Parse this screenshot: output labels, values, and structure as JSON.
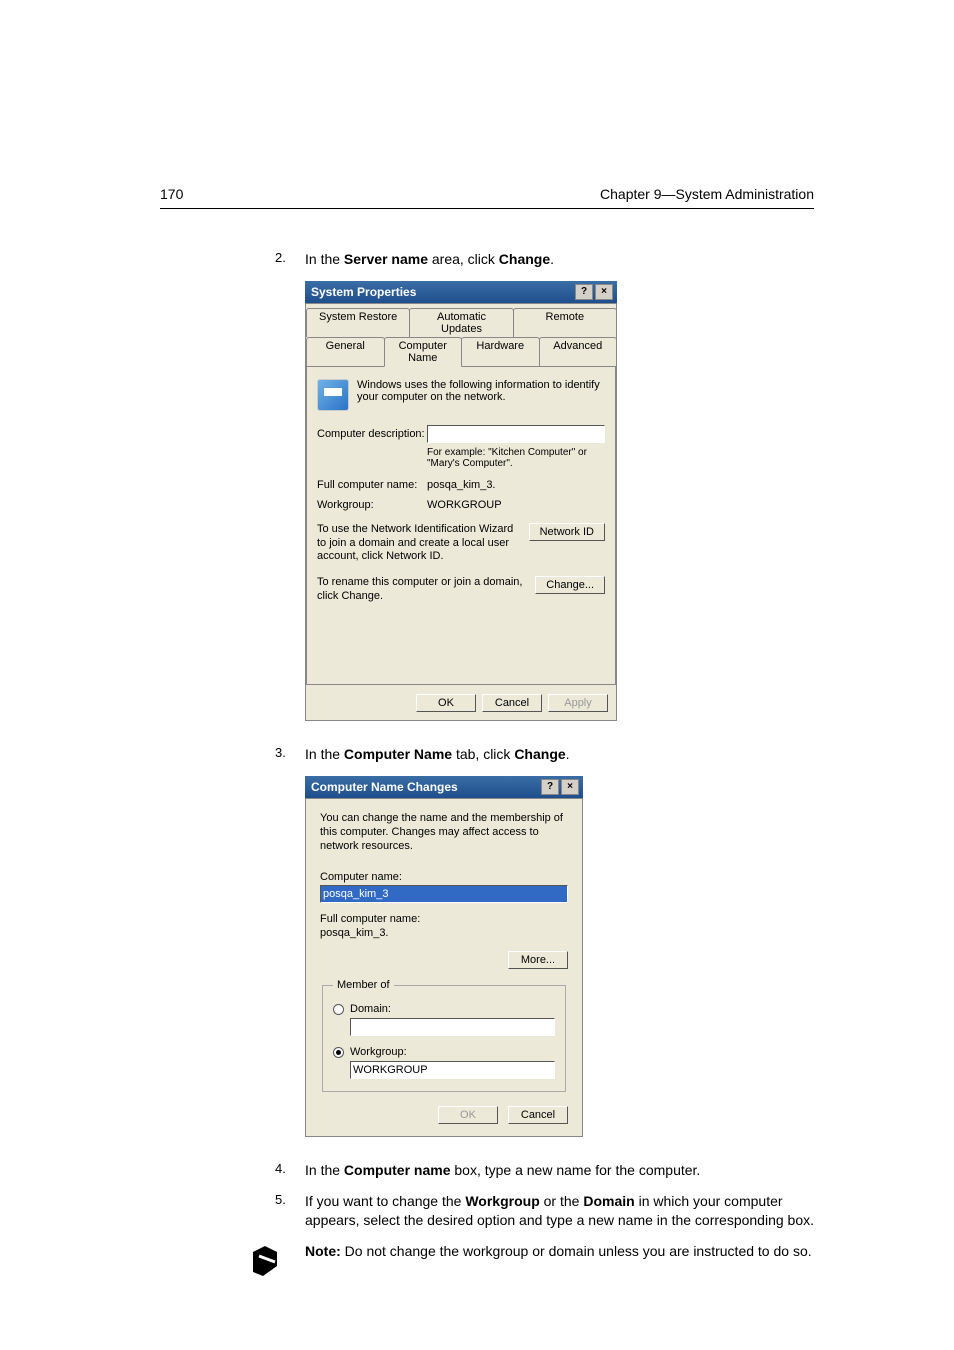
{
  "header": {
    "page_number": "170",
    "chapter": "Chapter 9—System Administration"
  },
  "steps": {
    "s2": {
      "num": "2.",
      "pre": "In the ",
      "b1": "Server name",
      "mid": " area, click ",
      "b2": "Change",
      "post": "."
    },
    "s3": {
      "num": "3.",
      "pre": "In the ",
      "b1": "Computer Name",
      "mid": " tab, click ",
      "b2": "Change",
      "post": "."
    },
    "s4": {
      "num": "4.",
      "pre": "In the ",
      "b1": "Computer name",
      "mid": " box, type a new name for the computer."
    },
    "s5": {
      "num": "5.",
      "pre": "If you want to change the ",
      "b1": "Workgroup",
      "mid": " or the ",
      "b2": "Domain",
      "post": " in which your computer appears, select the desired option and type a new name in the corresponding box."
    }
  },
  "note": {
    "label": "Note:",
    "text": "  Do not change the workgroup or domain unless you are instructed to do so."
  },
  "dlg1": {
    "title": "System Properties",
    "help_btn": "?",
    "close_btn": "×",
    "tabs_row1": {
      "t1": "System Restore",
      "t2": "Automatic Updates",
      "t3": "Remote"
    },
    "tabs_row2": {
      "t1": "General",
      "t2": "Computer Name",
      "t3": "Hardware",
      "t4": "Advanced"
    },
    "intro": "Windows uses the following information to identify your computer on the network.",
    "desc_label": "Computer description:",
    "desc_value": "",
    "example": "For example: \"Kitchen Computer\" or \"Mary's Computer\".",
    "fullname_label": "Full computer name:",
    "fullname_value": "posqa_kim_3.",
    "workgroup_label": "Workgroup:",
    "workgroup_value": "WORKGROUP",
    "wizard_text": "To use the Network Identification Wizard to join a domain and create a local user account, click Network ID.",
    "wizard_btn": "Network ID",
    "rename_text": "To rename this computer or join a domain, click Change.",
    "change_btn": "Change...",
    "ok": "OK",
    "cancel": "Cancel",
    "apply": "Apply"
  },
  "dlg2": {
    "title": "Computer Name Changes",
    "help_btn": "?",
    "close_btn": "×",
    "intro": "You can change the name and the membership of this computer. Changes may affect access to network resources.",
    "name_label": "Computer name:",
    "name_value": "posqa_kim_3",
    "fullname_label": "Full computer name:",
    "fullname_value": "posqa_kim_3.",
    "more_btn": "More...",
    "member_legend": "Member of",
    "domain_label": "Domain:",
    "domain_value": "",
    "workgroup_label": "Workgroup:",
    "workgroup_value": "WORKGROUP",
    "ok": "OK",
    "cancel": "Cancel"
  }
}
